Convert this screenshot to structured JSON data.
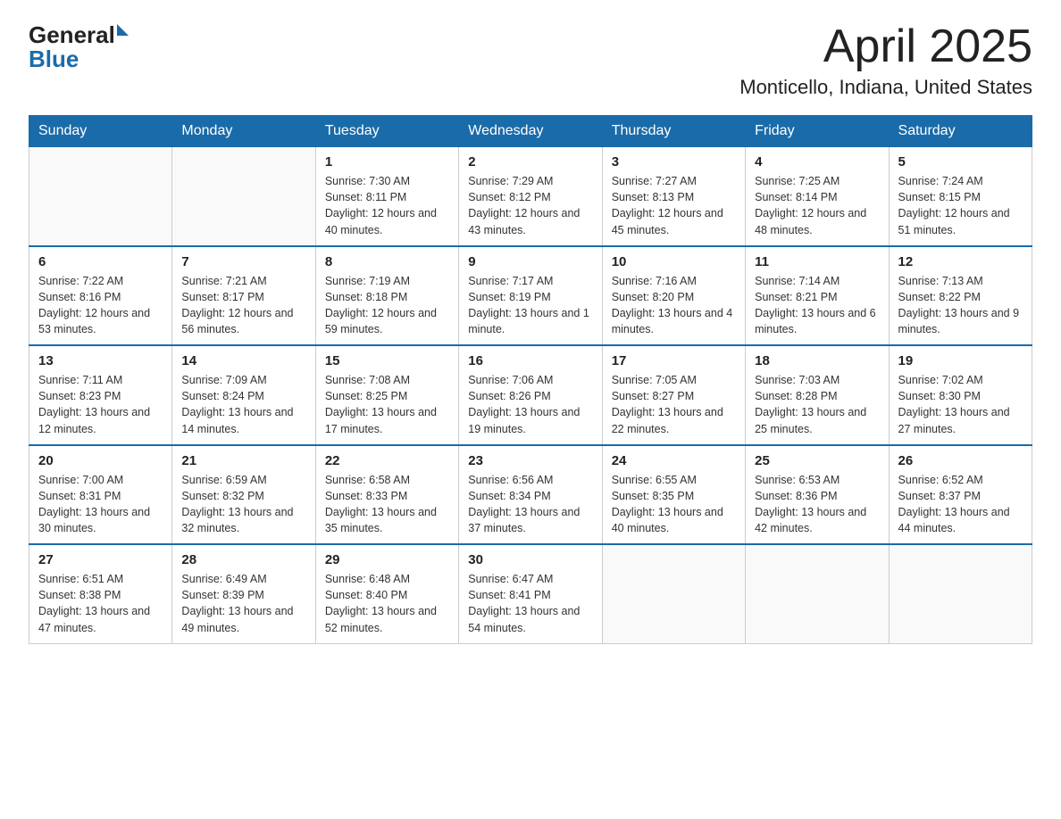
{
  "header": {
    "logo_general": "General",
    "logo_blue": "Blue",
    "title": "April 2025",
    "location": "Monticello, Indiana, United States"
  },
  "days_of_week": [
    "Sunday",
    "Monday",
    "Tuesday",
    "Wednesday",
    "Thursday",
    "Friday",
    "Saturday"
  ],
  "weeks": [
    [
      {
        "day": "",
        "sunrise": "",
        "sunset": "",
        "daylight": ""
      },
      {
        "day": "",
        "sunrise": "",
        "sunset": "",
        "daylight": ""
      },
      {
        "day": "1",
        "sunrise": "Sunrise: 7:30 AM",
        "sunset": "Sunset: 8:11 PM",
        "daylight": "Daylight: 12 hours and 40 minutes."
      },
      {
        "day": "2",
        "sunrise": "Sunrise: 7:29 AM",
        "sunset": "Sunset: 8:12 PM",
        "daylight": "Daylight: 12 hours and 43 minutes."
      },
      {
        "day": "3",
        "sunrise": "Sunrise: 7:27 AM",
        "sunset": "Sunset: 8:13 PM",
        "daylight": "Daylight: 12 hours and 45 minutes."
      },
      {
        "day": "4",
        "sunrise": "Sunrise: 7:25 AM",
        "sunset": "Sunset: 8:14 PM",
        "daylight": "Daylight: 12 hours and 48 minutes."
      },
      {
        "day": "5",
        "sunrise": "Sunrise: 7:24 AM",
        "sunset": "Sunset: 8:15 PM",
        "daylight": "Daylight: 12 hours and 51 minutes."
      }
    ],
    [
      {
        "day": "6",
        "sunrise": "Sunrise: 7:22 AM",
        "sunset": "Sunset: 8:16 PM",
        "daylight": "Daylight: 12 hours and 53 minutes."
      },
      {
        "day": "7",
        "sunrise": "Sunrise: 7:21 AM",
        "sunset": "Sunset: 8:17 PM",
        "daylight": "Daylight: 12 hours and 56 minutes."
      },
      {
        "day": "8",
        "sunrise": "Sunrise: 7:19 AM",
        "sunset": "Sunset: 8:18 PM",
        "daylight": "Daylight: 12 hours and 59 minutes."
      },
      {
        "day": "9",
        "sunrise": "Sunrise: 7:17 AM",
        "sunset": "Sunset: 8:19 PM",
        "daylight": "Daylight: 13 hours and 1 minute."
      },
      {
        "day": "10",
        "sunrise": "Sunrise: 7:16 AM",
        "sunset": "Sunset: 8:20 PM",
        "daylight": "Daylight: 13 hours and 4 minutes."
      },
      {
        "day": "11",
        "sunrise": "Sunrise: 7:14 AM",
        "sunset": "Sunset: 8:21 PM",
        "daylight": "Daylight: 13 hours and 6 minutes."
      },
      {
        "day": "12",
        "sunrise": "Sunrise: 7:13 AM",
        "sunset": "Sunset: 8:22 PM",
        "daylight": "Daylight: 13 hours and 9 minutes."
      }
    ],
    [
      {
        "day": "13",
        "sunrise": "Sunrise: 7:11 AM",
        "sunset": "Sunset: 8:23 PM",
        "daylight": "Daylight: 13 hours and 12 minutes."
      },
      {
        "day": "14",
        "sunrise": "Sunrise: 7:09 AM",
        "sunset": "Sunset: 8:24 PM",
        "daylight": "Daylight: 13 hours and 14 minutes."
      },
      {
        "day": "15",
        "sunrise": "Sunrise: 7:08 AM",
        "sunset": "Sunset: 8:25 PM",
        "daylight": "Daylight: 13 hours and 17 minutes."
      },
      {
        "day": "16",
        "sunrise": "Sunrise: 7:06 AM",
        "sunset": "Sunset: 8:26 PM",
        "daylight": "Daylight: 13 hours and 19 minutes."
      },
      {
        "day": "17",
        "sunrise": "Sunrise: 7:05 AM",
        "sunset": "Sunset: 8:27 PM",
        "daylight": "Daylight: 13 hours and 22 minutes."
      },
      {
        "day": "18",
        "sunrise": "Sunrise: 7:03 AM",
        "sunset": "Sunset: 8:28 PM",
        "daylight": "Daylight: 13 hours and 25 minutes."
      },
      {
        "day": "19",
        "sunrise": "Sunrise: 7:02 AM",
        "sunset": "Sunset: 8:30 PM",
        "daylight": "Daylight: 13 hours and 27 minutes."
      }
    ],
    [
      {
        "day": "20",
        "sunrise": "Sunrise: 7:00 AM",
        "sunset": "Sunset: 8:31 PM",
        "daylight": "Daylight: 13 hours and 30 minutes."
      },
      {
        "day": "21",
        "sunrise": "Sunrise: 6:59 AM",
        "sunset": "Sunset: 8:32 PM",
        "daylight": "Daylight: 13 hours and 32 minutes."
      },
      {
        "day": "22",
        "sunrise": "Sunrise: 6:58 AM",
        "sunset": "Sunset: 8:33 PM",
        "daylight": "Daylight: 13 hours and 35 minutes."
      },
      {
        "day": "23",
        "sunrise": "Sunrise: 6:56 AM",
        "sunset": "Sunset: 8:34 PM",
        "daylight": "Daylight: 13 hours and 37 minutes."
      },
      {
        "day": "24",
        "sunrise": "Sunrise: 6:55 AM",
        "sunset": "Sunset: 8:35 PM",
        "daylight": "Daylight: 13 hours and 40 minutes."
      },
      {
        "day": "25",
        "sunrise": "Sunrise: 6:53 AM",
        "sunset": "Sunset: 8:36 PM",
        "daylight": "Daylight: 13 hours and 42 minutes."
      },
      {
        "day": "26",
        "sunrise": "Sunrise: 6:52 AM",
        "sunset": "Sunset: 8:37 PM",
        "daylight": "Daylight: 13 hours and 44 minutes."
      }
    ],
    [
      {
        "day": "27",
        "sunrise": "Sunrise: 6:51 AM",
        "sunset": "Sunset: 8:38 PM",
        "daylight": "Daylight: 13 hours and 47 minutes."
      },
      {
        "day": "28",
        "sunrise": "Sunrise: 6:49 AM",
        "sunset": "Sunset: 8:39 PM",
        "daylight": "Daylight: 13 hours and 49 minutes."
      },
      {
        "day": "29",
        "sunrise": "Sunrise: 6:48 AM",
        "sunset": "Sunset: 8:40 PM",
        "daylight": "Daylight: 13 hours and 52 minutes."
      },
      {
        "day": "30",
        "sunrise": "Sunrise: 6:47 AM",
        "sunset": "Sunset: 8:41 PM",
        "daylight": "Daylight: 13 hours and 54 minutes."
      },
      {
        "day": "",
        "sunrise": "",
        "sunset": "",
        "daylight": ""
      },
      {
        "day": "",
        "sunrise": "",
        "sunset": "",
        "daylight": ""
      },
      {
        "day": "",
        "sunrise": "",
        "sunset": "",
        "daylight": ""
      }
    ]
  ]
}
